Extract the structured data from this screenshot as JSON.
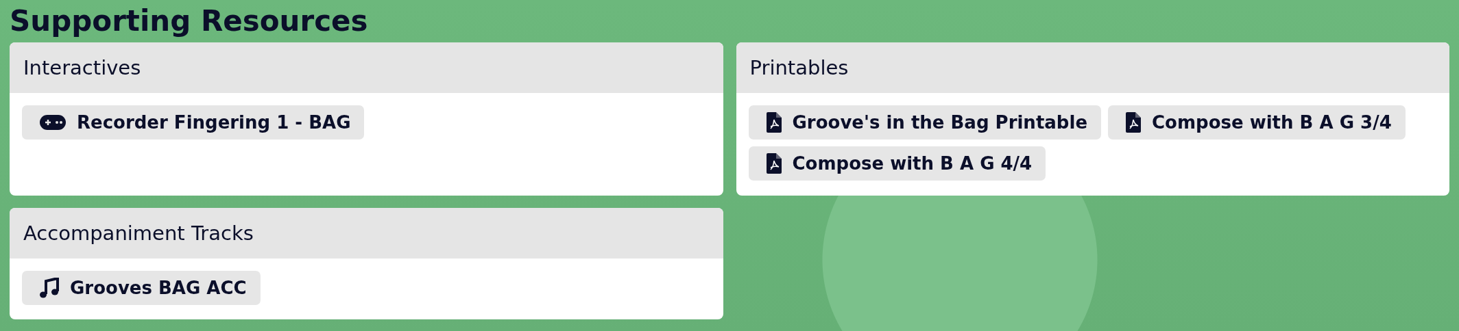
{
  "title": "Supporting Resources",
  "sections": [
    {
      "heading": "Interactives",
      "items": [
        {
          "kind": "game",
          "label": "Recorder Fingering 1 - BAG"
        }
      ]
    },
    {
      "heading": "Printables",
      "items": [
        {
          "kind": "pdf",
          "label": "Groove's in the Bag Printable"
        },
        {
          "kind": "pdf",
          "label": "Compose with B A G 3/4"
        },
        {
          "kind": "pdf",
          "label": "Compose with B A G 4/4"
        }
      ]
    },
    {
      "heading": "Accompaniment Tracks",
      "items": [
        {
          "kind": "music",
          "label": "Grooves BAG ACC"
        }
      ]
    }
  ]
}
